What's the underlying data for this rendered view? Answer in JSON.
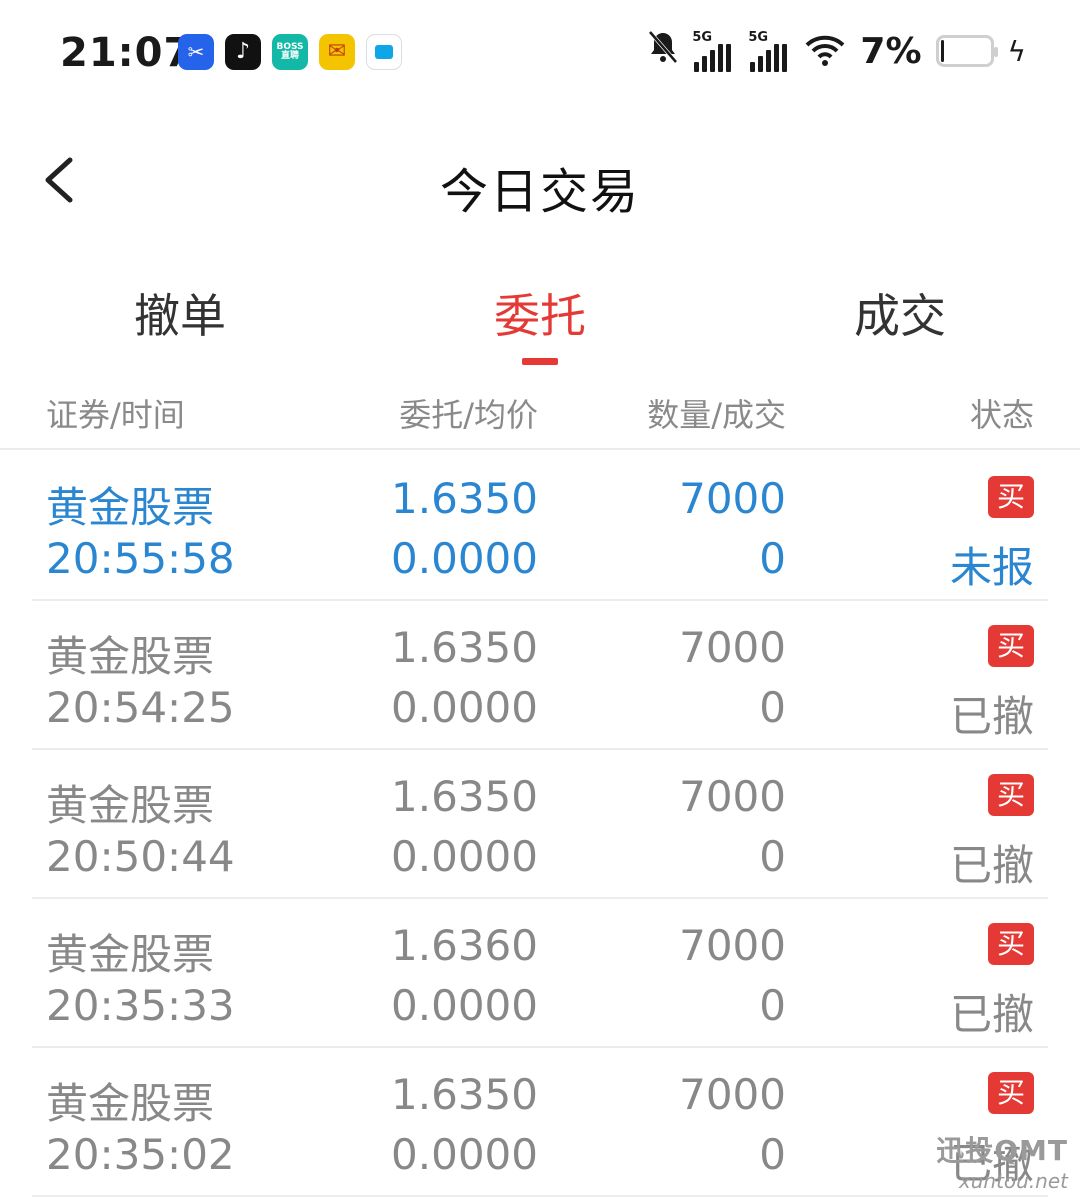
{
  "status_bar": {
    "time": "21:07",
    "signal1_label": "5G",
    "signal2_label": "5G",
    "battery_pct": "7%",
    "battery_level": 0.07,
    "boss_label": "BOSS直聘"
  },
  "header": {
    "title": "今日交易"
  },
  "tabs": [
    {
      "label": "撤单"
    },
    {
      "label": "委托"
    },
    {
      "label": "成交"
    }
  ],
  "active_tab": 1,
  "columns": {
    "security_time": "证券/时间",
    "price_avg": "委托/均价",
    "qty_filled": "数量/成交",
    "status": "状态"
  },
  "rows": [
    {
      "name": "黄金股票",
      "time": "20:55:58",
      "price": "1.6350",
      "avg": "0.0000",
      "qty": "7000",
      "filled": "0",
      "side": "买",
      "status": "未报"
    },
    {
      "name": "黄金股票",
      "time": "20:54:25",
      "price": "1.6350",
      "avg": "0.0000",
      "qty": "7000",
      "filled": "0",
      "side": "买",
      "status": "已撤"
    },
    {
      "name": "黄金股票",
      "time": "20:50:44",
      "price": "1.6350",
      "avg": "0.0000",
      "qty": "7000",
      "filled": "0",
      "side": "买",
      "status": "已撤"
    },
    {
      "name": "黄金股票",
      "time": "20:35:33",
      "price": "1.6360",
      "avg": "0.0000",
      "qty": "7000",
      "filled": "0",
      "side": "买",
      "status": "已撤"
    },
    {
      "name": "黄金股票",
      "time": "20:35:02",
      "price": "1.6350",
      "avg": "0.0000",
      "qty": "7000",
      "filled": "0",
      "side": "买",
      "status": "已撤"
    }
  ],
  "watermark": {
    "line1": "迅投QMT",
    "line2": "xuntou.net"
  },
  "colors": {
    "accent_red": "#e53935",
    "active_blue": "#2a86d1",
    "muted_gray": "#888888"
  }
}
